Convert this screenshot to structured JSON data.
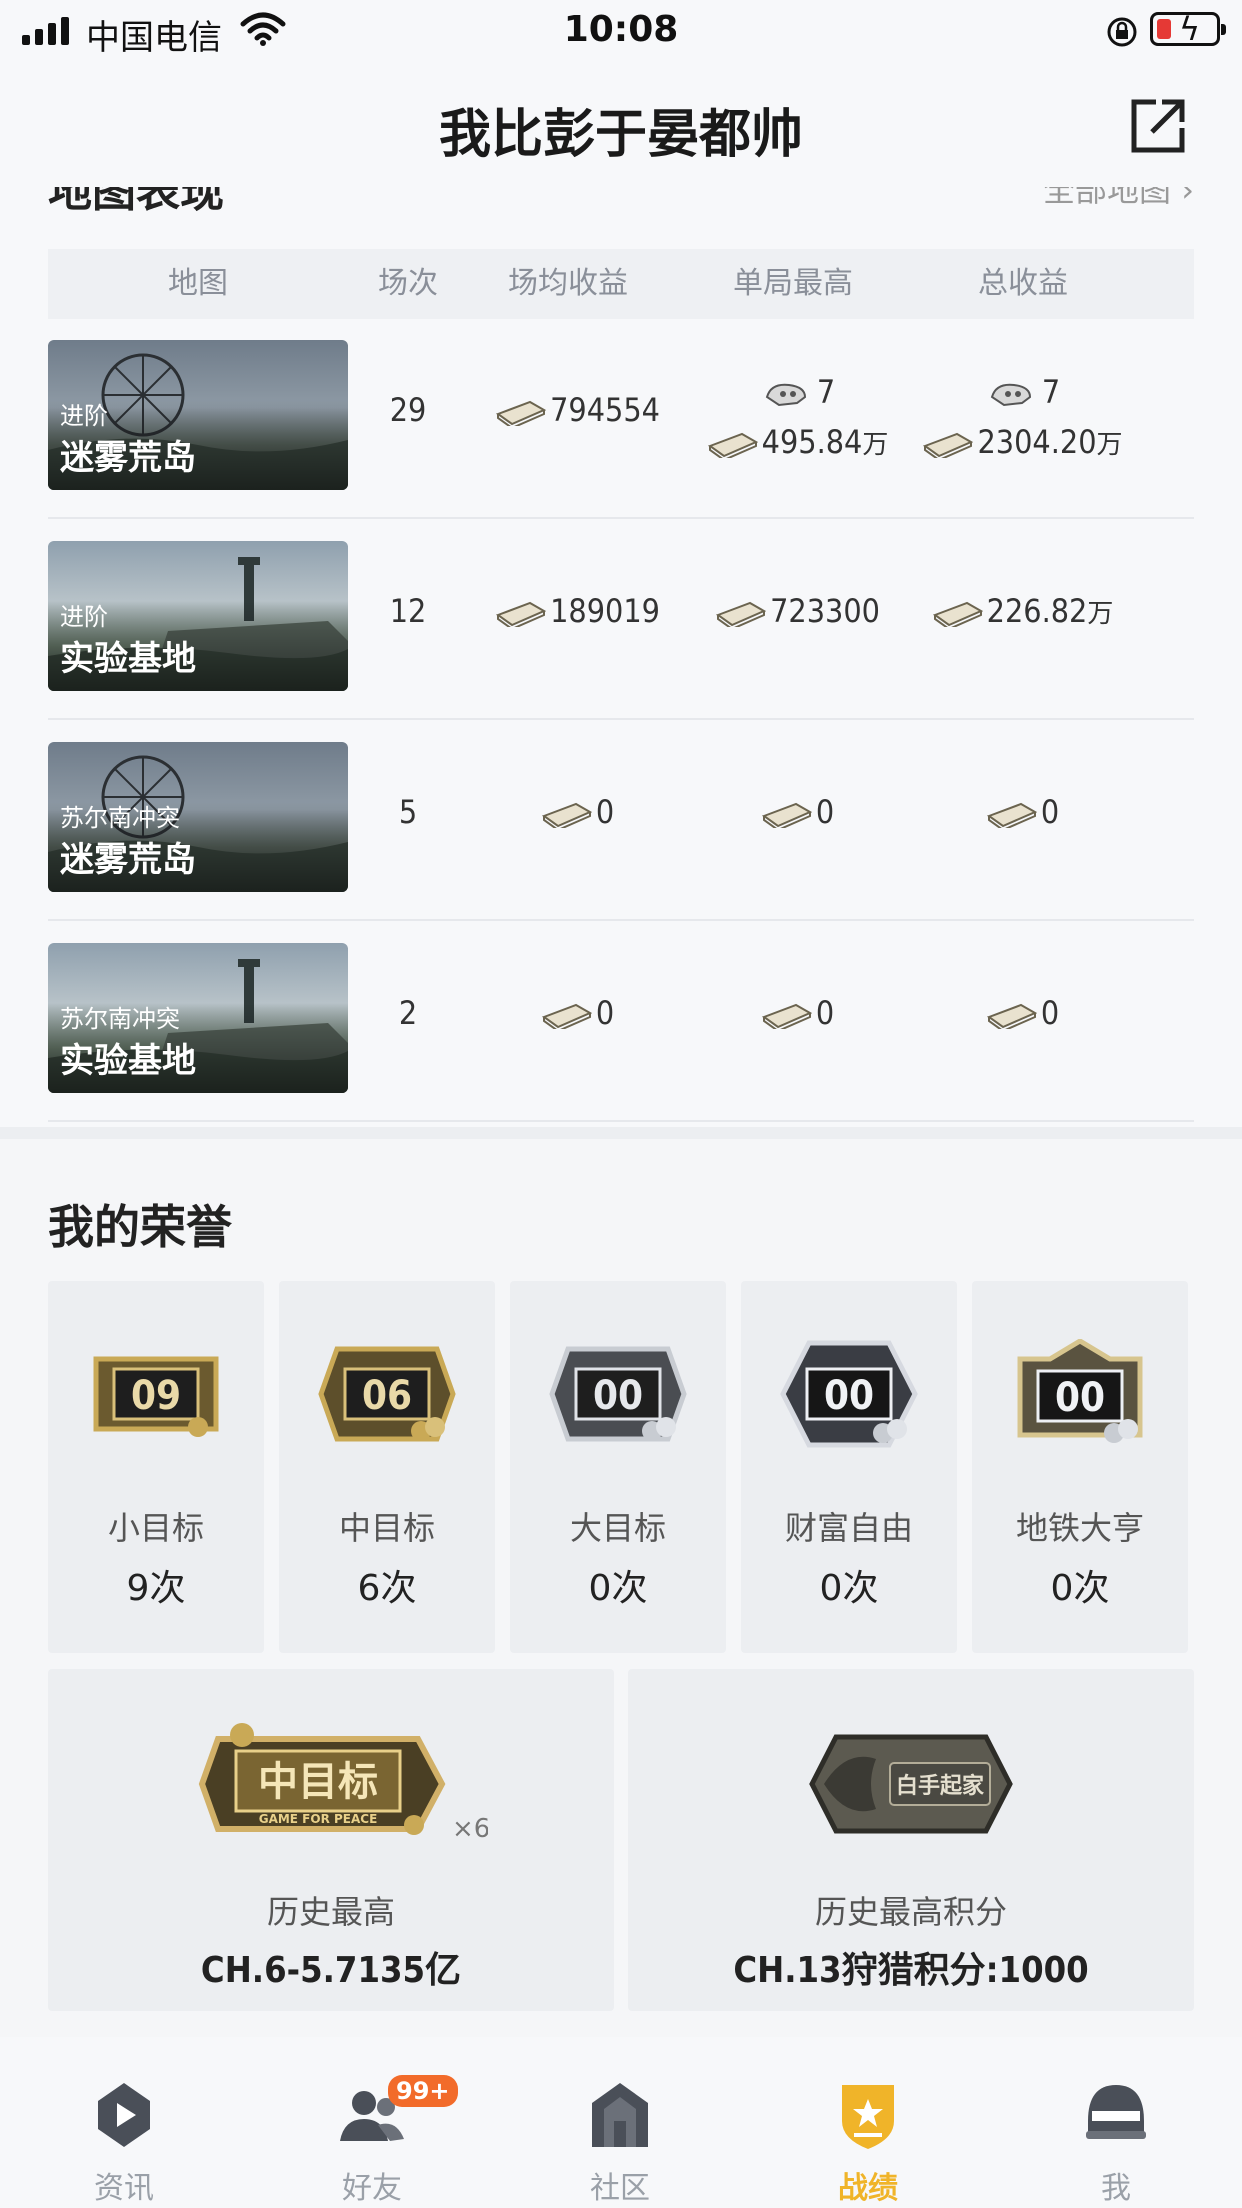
{
  "status_bar": {
    "carrier": "中国电信",
    "time": "10:08"
  },
  "nav": {
    "title": "我比彭于晏都帅",
    "share_icon": "share-external-icon"
  },
  "map_performance": {
    "section_title_partial": "地图表现",
    "view_all_partial": "全部地图 ›",
    "columns": [
      "地图",
      "场次",
      "场均收益",
      "单局最高",
      "总收益"
    ],
    "rows": [
      {
        "mode": "进阶",
        "map": "迷雾荒岛",
        "matches": "29",
        "avg": "794554",
        "best_kills": "7",
        "best_value": "495.84",
        "best_unit": "万",
        "total_kills": "7",
        "total_value": "2304.20",
        "total_unit": "万"
      },
      {
        "mode": "进阶",
        "map": "实验基地",
        "matches": "12",
        "avg": "189019",
        "best_value": "723300",
        "best_unit": "",
        "total_value": "226.82",
        "total_unit": "万"
      },
      {
        "mode": "苏尔南冲突",
        "map": "迷雾荒岛",
        "matches": "5",
        "avg": "0",
        "best_value": "0",
        "best_unit": "",
        "total_value": "0",
        "total_unit": ""
      },
      {
        "mode": "苏尔南冲突",
        "map": "实验基地",
        "matches": "2",
        "avg": "0",
        "best_value": "0",
        "best_unit": "",
        "total_value": "0",
        "total_unit": ""
      }
    ]
  },
  "honors": {
    "title": "我的荣誉",
    "badges": [
      {
        "badge_text": "09",
        "name": "小目标",
        "count": "9次"
      },
      {
        "badge_text": "06",
        "name": "中目标",
        "count": "6次"
      },
      {
        "badge_text": "00",
        "name": "大目标",
        "count": "0次"
      },
      {
        "badge_text": "00",
        "name": "财富自由",
        "count": "0次"
      },
      {
        "badge_text": "00",
        "name": "地铁大亨",
        "count": "0次"
      }
    ],
    "records": [
      {
        "emblem_text": "中目标",
        "emblem_sub": "GAME FOR PEACE",
        "multiplier": "×6",
        "label": "历史最高",
        "value": "CH.6-5.7135亿"
      },
      {
        "emblem_text": "白手起家",
        "label": "历史最高积分",
        "value": "CH.13狩猎积分:1000"
      }
    ]
  },
  "tab_bar": {
    "tabs": [
      {
        "label": "资讯",
        "icon": "news-play-icon"
      },
      {
        "label": "好友",
        "icon": "friends-icon",
        "badge": "99+"
      },
      {
        "label": "社区",
        "icon": "community-house-icon"
      },
      {
        "label": "战绩",
        "icon": "record-shield-icon",
        "active": true
      },
      {
        "label": "我",
        "icon": "helmet-icon"
      }
    ]
  }
}
